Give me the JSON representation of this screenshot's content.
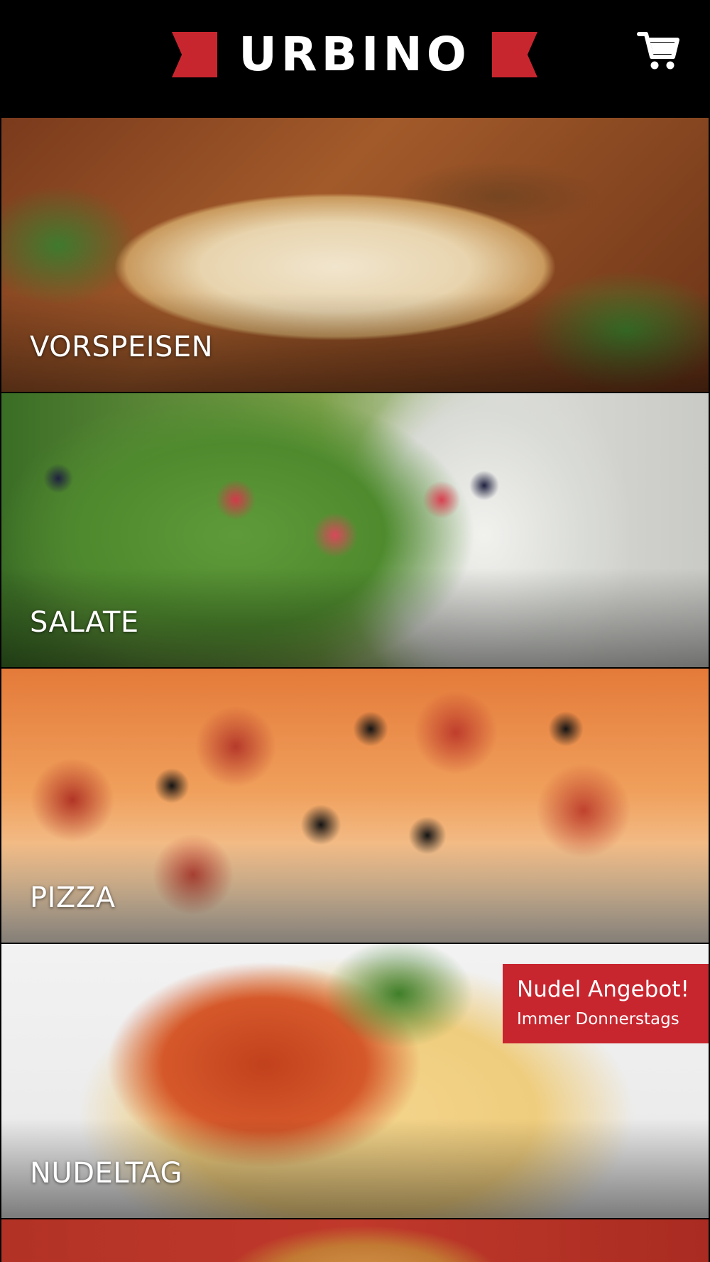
{
  "header": {
    "logo_text": "URBINO",
    "cart_icon": "cart-icon",
    "brand_color": "#c8262f"
  },
  "categories": [
    {
      "label": "VORSPEISEN"
    },
    {
      "label": "SALATE"
    },
    {
      "label": "PIZZA"
    },
    {
      "label": "NUDELTAG"
    },
    {
      "label": ""
    }
  ],
  "promo": {
    "title": "Nudel Angebot!",
    "subtitle": "Immer Donnerstags"
  }
}
